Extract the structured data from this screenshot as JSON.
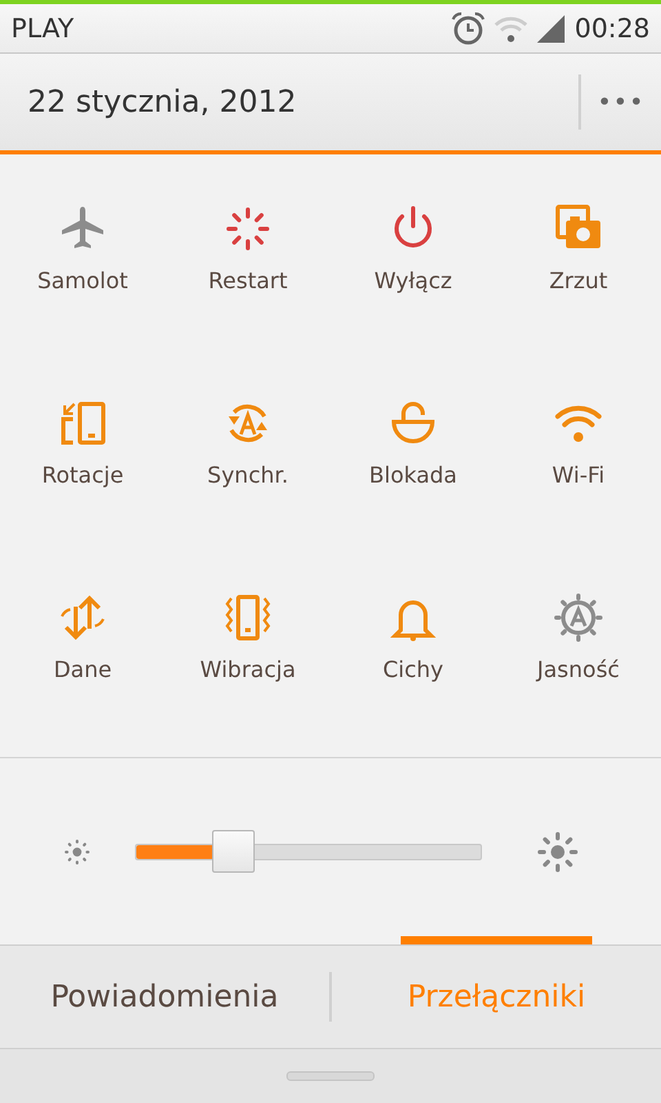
{
  "status_bar": {
    "carrier": "PLAY",
    "time": "00:28"
  },
  "header": {
    "date": "22 stycznia, 2012",
    "menu": "•••"
  },
  "toggles": [
    {
      "label": "Samolot",
      "kind": "toggle",
      "on": false
    },
    {
      "label": "Restart",
      "kind": "action"
    },
    {
      "label": "Wyłącz",
      "kind": "action"
    },
    {
      "label": "Zrzut",
      "kind": "toggle",
      "on": true
    },
    {
      "label": "Rotacje",
      "kind": "toggle",
      "on": true
    },
    {
      "label": "Synchr.",
      "kind": "toggle",
      "on": true
    },
    {
      "label": "Blokada",
      "kind": "toggle",
      "on": true
    },
    {
      "label": "Wi-Fi",
      "kind": "toggle",
      "on": true
    },
    {
      "label": "Dane",
      "kind": "toggle",
      "on": true
    },
    {
      "label": "Wibracja",
      "kind": "toggle",
      "on": true
    },
    {
      "label": "Cichy",
      "kind": "toggle",
      "on": true
    },
    {
      "label": "Jasność",
      "kind": "toggle",
      "on": false
    }
  ],
  "brightness": {
    "level": 0.28
  },
  "tabs": [
    {
      "label": "Powiadomienia",
      "selected": false
    },
    {
      "label": "Przełączniki",
      "selected": true
    }
  ]
}
